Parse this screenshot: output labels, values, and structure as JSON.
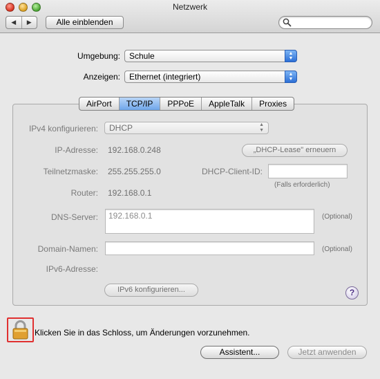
{
  "window": {
    "title": "Netzwerk"
  },
  "toolbar": {
    "back_icon": "back-arrow-icon",
    "forward_icon": "forward-arrow-icon",
    "back_glyph": "◀",
    "forward_glyph": "▶",
    "show_all_label": "Alle einblenden",
    "search_placeholder": ""
  },
  "location": {
    "label": "Umgebung:",
    "value": "Schule"
  },
  "show": {
    "label": "Anzeigen:",
    "value": "Ethernet (integriert)"
  },
  "tabs": [
    {
      "label": "AirPort",
      "active": false
    },
    {
      "label": "TCP/IP",
      "active": true
    },
    {
      "label": "PPPoE",
      "active": false
    },
    {
      "label": "AppleTalk",
      "active": false
    },
    {
      "label": "Proxies",
      "active": false
    }
  ],
  "tcpip": {
    "ipv4_label": "IPv4 konfigurieren:",
    "ipv4_value": "DHCP",
    "ip_label": "IP-Adresse:",
    "ip_value": "192.168.0.248",
    "renew_button": "„DHCP-Lease\" erneuern",
    "subnet_label": "Teilnetzmaske:",
    "subnet_value": "255.255.255.0",
    "client_id_label": "DHCP-Client-ID:",
    "client_id_value": "",
    "client_id_hint": "(Falls erforderlich)",
    "router_label": "Router:",
    "router_value": "192.168.0.1",
    "dns_label": "DNS-Server:",
    "dns_value": "192.168.0.1",
    "dns_hint": "(Optional)",
    "domain_label": "Domain-Namen:",
    "domain_value": "",
    "domain_hint": "(Optional)",
    "ipv6_label": "IPv6-Adresse:",
    "ipv6_button": "IPv6 konfigurieren...",
    "help_glyph": "?"
  },
  "footer": {
    "lock_message": "Klicken Sie in das Schloss, um Änderungen vorzunehmen.",
    "assistant_button": "Assistent...",
    "apply_button": "Jetzt anwenden"
  },
  "colors": {
    "lock_highlight": "#e03030",
    "selected_tab": "#6fa6ea",
    "popup_arrows": "#2d6fd6"
  }
}
